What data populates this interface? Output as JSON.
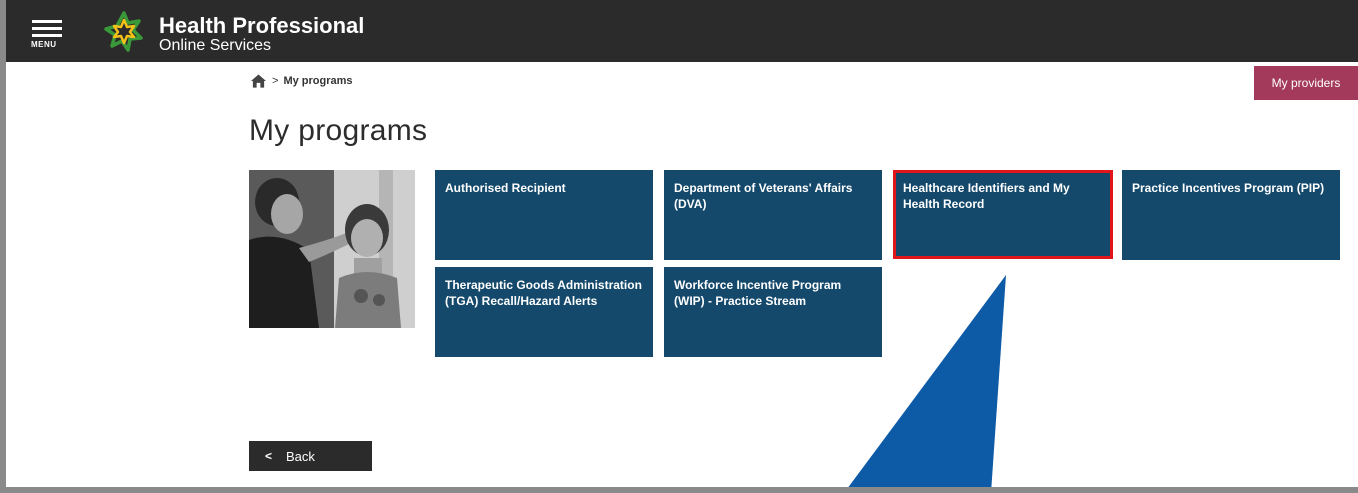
{
  "header": {
    "menu_label": "MENU",
    "brand_title": "Health Professional",
    "brand_subtitle": "Online Services",
    "colors": {
      "bar": "#2b2b2b",
      "logo_green": "#3a9a3a",
      "logo_yellow": "#f2c21a"
    }
  },
  "breadcrumb": {
    "home_icon": "home-icon",
    "separator": ">",
    "current": "My programs"
  },
  "actions": {
    "my_providers_label": "My providers",
    "back_label": "Back"
  },
  "page": {
    "title": "My programs",
    "photo_icon": "photo-nurse-child"
  },
  "programs": [
    {
      "label": "Authorised Recipient"
    },
    {
      "label": "Department of Veterans' Affairs (DVA)"
    },
    {
      "label": "Healthcare Identifiers and My Health Record",
      "highlighted": true
    },
    {
      "label": "Practice Incentives Program (PIP)"
    },
    {
      "label": "Therapeutic Goods Administration (TGA) Recall/Hazard Alerts"
    },
    {
      "label": "Workforce Incentive Program (WIP) - Practice Stream"
    }
  ],
  "colors": {
    "tile": "#14496b",
    "highlight_border": "#e0161b",
    "providers_button": "#a33a5b",
    "annotation_arrow": "#0d5aa7"
  }
}
